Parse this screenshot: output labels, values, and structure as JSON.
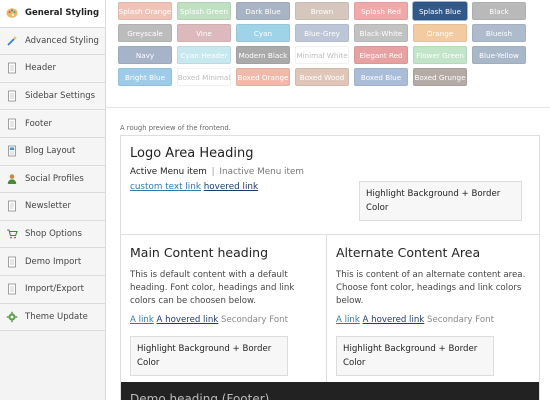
{
  "sidebar": {
    "items": [
      {
        "label": "General Styling",
        "icon": "palette-icon",
        "active": true
      },
      {
        "label": "Advanced Styling",
        "icon": "magic-wand-icon"
      },
      {
        "label": "Header",
        "icon": "document-icon"
      },
      {
        "label": "Sidebar Settings",
        "icon": "document-icon"
      },
      {
        "label": "Footer",
        "icon": "document-icon"
      },
      {
        "label": "Blog Layout",
        "icon": "blog-icon"
      },
      {
        "label": "Social Profiles",
        "icon": "person-icon"
      },
      {
        "label": "Newsletter",
        "icon": "envelope-icon"
      },
      {
        "label": "Shop Options",
        "icon": "cart-icon"
      },
      {
        "label": "Demo Import",
        "icon": "document-icon"
      },
      {
        "label": "Import/Export",
        "icon": "document-icon"
      },
      {
        "label": "Theme Update",
        "icon": "gear-icon"
      }
    ]
  },
  "swatches": [
    {
      "label": "Splash Orange",
      "color": "#f0c3b6",
      "text": "#ffffff"
    },
    {
      "label": "Splash Green",
      "color": "#bfe0c1",
      "text": "#ffffff"
    },
    {
      "label": "Dark Blue",
      "color": "#a8b3c4",
      "text": "#ffffff"
    },
    {
      "label": "Brown",
      "color": "#d5c7be",
      "text": "#ffffff"
    },
    {
      "label": "Splash Red",
      "color": "#f0a8a8",
      "text": "#ffffff"
    },
    {
      "label": "Splash Blue",
      "color": "#33588a",
      "text": "#ffffff",
      "selected": true
    },
    {
      "label": "Black",
      "color": "#b9b9b9",
      "text": "#ffffff"
    },
    {
      "label": "Greyscale",
      "color": "#bcbcbc",
      "text": "#ffffff"
    },
    {
      "label": "Vine",
      "color": "#dbb9bd",
      "text": "#ffffff"
    },
    {
      "label": "Cyan",
      "color": "#9fd3e8",
      "text": "#ffffff"
    },
    {
      "label": "Blue-Grey",
      "color": "#bcc6d6",
      "text": "#ffffff"
    },
    {
      "label": "Black-White",
      "color": "#c2c2c2",
      "text": "#ffffff"
    },
    {
      "label": "Orange",
      "color": "#f3cba1",
      "text": "#ffffff"
    },
    {
      "label": "Blueish",
      "color": "#aebbcc",
      "text": "#ffffff"
    },
    {
      "label": "Navy",
      "color": "#a6b3c9",
      "text": "#ffffff"
    },
    {
      "label": "Cyan Header",
      "color": "#c6e8ee",
      "text": "#ffffff"
    },
    {
      "label": "Modern Black",
      "color": "#aaaaaa",
      "text": "#ffffff"
    },
    {
      "label": "Minimal White",
      "color": "#ffffff",
      "text": "#bcbcbc"
    },
    {
      "label": "Elegant Red",
      "color": "#e8a1a1",
      "text": "#ffffff"
    },
    {
      "label": "Flower Green",
      "color": "#c2e4c9",
      "text": "#ffffff"
    },
    {
      "label": "Blue-Yellow",
      "color": "#a9b8c9",
      "text": "#ffffff"
    },
    {
      "label": "Bright Blue",
      "color": "#9ecbe8",
      "text": "#ffffff"
    },
    {
      "label": "Boxed Minimal",
      "color": "#ffffff",
      "text": "#bcbcbc"
    },
    {
      "label": "Boxed Orange",
      "color": "#f0b9a9",
      "text": "#ffffff"
    },
    {
      "label": "Boxed Wood",
      "color": "#dfc6b8",
      "text": "#ffffff"
    },
    {
      "label": "Boxed Blue",
      "color": "#a9bdd8",
      "text": "#ffffff"
    },
    {
      "label": "Boxed Grunge",
      "color": "#b4aaa6",
      "text": "#ffffff"
    }
  ],
  "preview": {
    "note": "A rough preview of the frontend.",
    "logo_heading": "Logo Area Heading",
    "active_menu": "Active Menu item",
    "menu_sep": "|",
    "inactive_menu": "Inactive Menu item",
    "custom_link": "custom text link",
    "hovered_link": "hovered link",
    "highlight_top": "Highlight Background + Border Color",
    "main_heading": "Main Content heading",
    "main_text": "This is default content with a default heading. Font color, headings and link colors can be choosen below.",
    "main_link": "A link",
    "main_hovered": "A hovered link",
    "main_secondary": "Secondary Font",
    "main_highlight": "Highlight Background + Border Color",
    "alt_heading": "Alternate Content Area",
    "alt_text": "This is content of an alternate content area. Choose font color, headings and link colors below.",
    "alt_link": "A link",
    "alt_hovered": "A hovered link",
    "alt_secondary": "Secondary Font",
    "alt_highlight": "Highlight Background + Border Color",
    "footer_heading": "Demo heading (Footer)"
  }
}
